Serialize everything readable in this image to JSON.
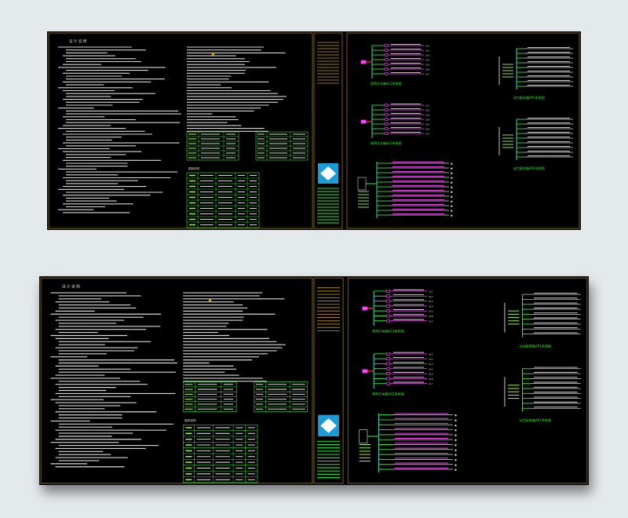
{
  "drawing": {
    "notes_title": "设 计 说 明",
    "table_header": "图例说明",
    "diagram_labels": [
      "照明开关箱AL1系统图",
      "照明开关箱AL2系统图",
      "动力配电箱AP1系统图",
      "动力配电箱AP2系统图"
    ],
    "colors": {
      "background": "#000000",
      "page": "#e4e9ec",
      "frame": "#c8a000",
      "text": "#d8d8d8",
      "green": "#2ee82e",
      "lime": "#a8ff3c",
      "magenta": "#ff40ff",
      "red": "#ff3030",
      "blue": "#3a5cff",
      "cyan": "#2ad8d8"
    }
  }
}
